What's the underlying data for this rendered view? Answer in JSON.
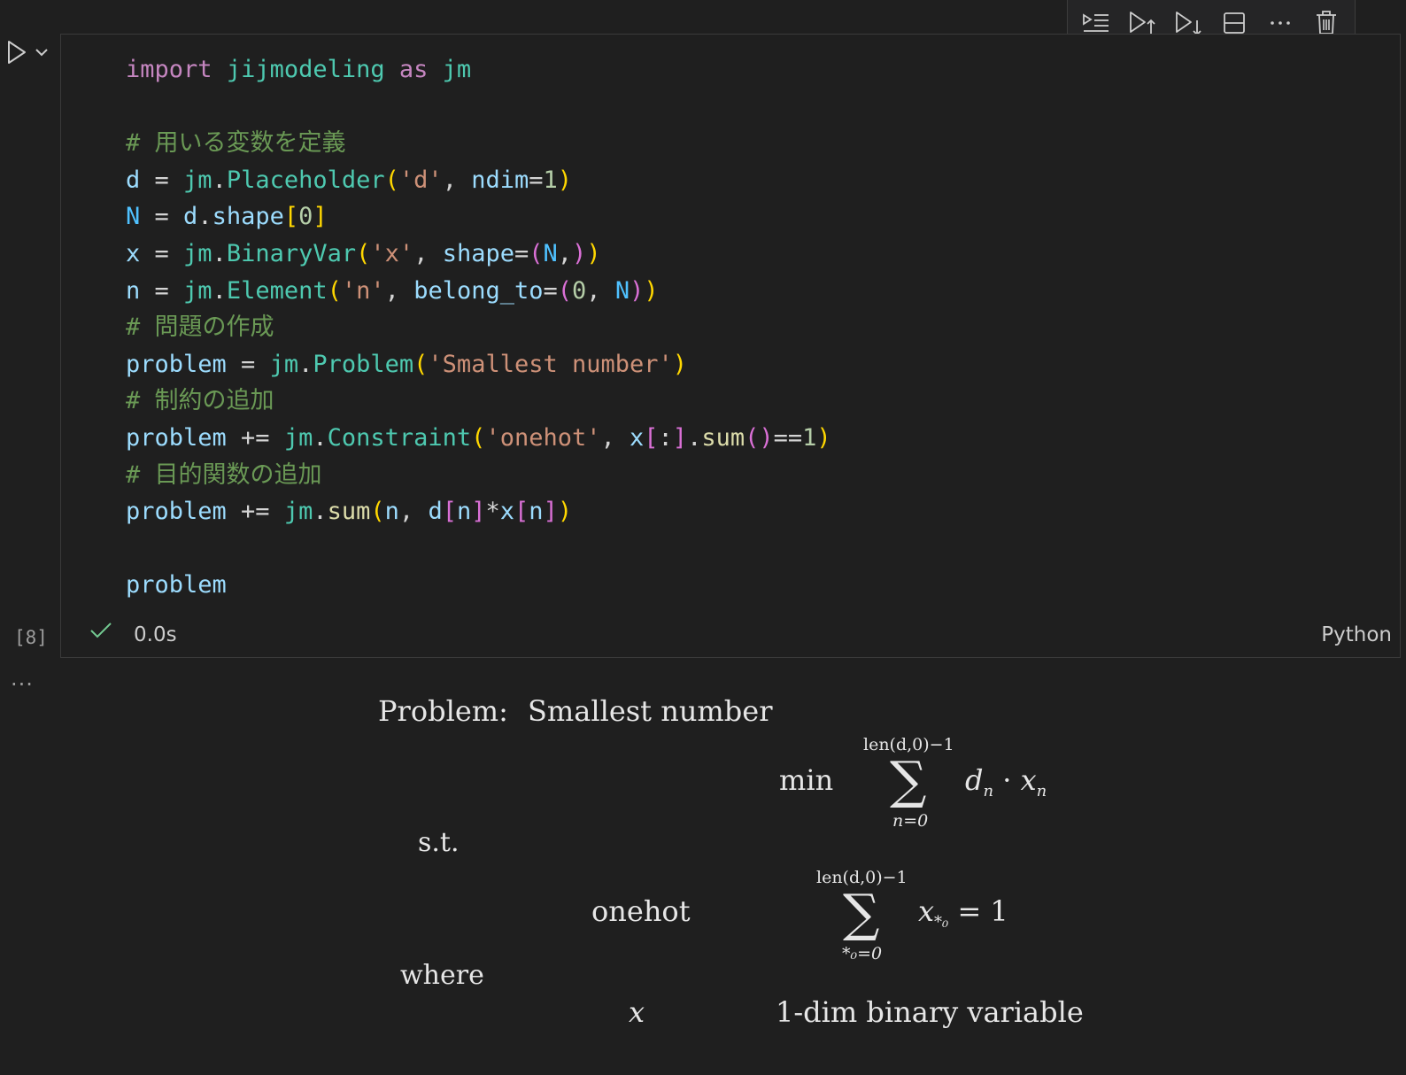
{
  "toolbar": {
    "buttons": [
      "execute-above-icon",
      "run-above-icon",
      "run-below-icon",
      "split-cell-icon",
      "more-icon",
      "delete-icon"
    ]
  },
  "cell": {
    "execution_count": "[8]",
    "status_time": "0.0s",
    "language": "Python",
    "source_lines": [
      "import jijmodeling as jm",
      "",
      "# 用いる変数を定義",
      "d = jm.Placeholder('d', ndim=1)",
      "N = d.shape[0]",
      "x = jm.BinaryVar('x', shape=(N,))",
      "n = jm.Element('n', belong_to=(0, N))",
      "# 問題の作成",
      "problem = jm.Problem('Smallest number')",
      "# 制約の追加",
      "problem += jm.Constraint('onehot', x[:].sum()==1)",
      "# 目的関数の追加",
      "problem += jm.sum(n, d[n]*x[n])",
      "",
      "problem"
    ]
  },
  "output": {
    "more": "...",
    "problem_label": "Problem:",
    "problem_name": "Smallest number",
    "objective_sense": "min",
    "objective_sum_upper": "len(d,0)−1",
    "objective_sum_lower": "n=0",
    "objective_term_1": "d",
    "objective_term_1_sub": "n",
    "objective_dot": "·",
    "objective_term_2": "x",
    "objective_term_2_sub": "n",
    "st_label": "s.t.",
    "constraint_name": "onehot",
    "constraint_sum_upper": "len(d,0)−1",
    "constraint_sum_lower": "*₀=0",
    "constraint_term": "x",
    "constraint_term_sub": "*₀",
    "constraint_rhs": "= 1",
    "where_label": "where",
    "var_name": "x",
    "var_desc": "1-dim binary variable"
  }
}
